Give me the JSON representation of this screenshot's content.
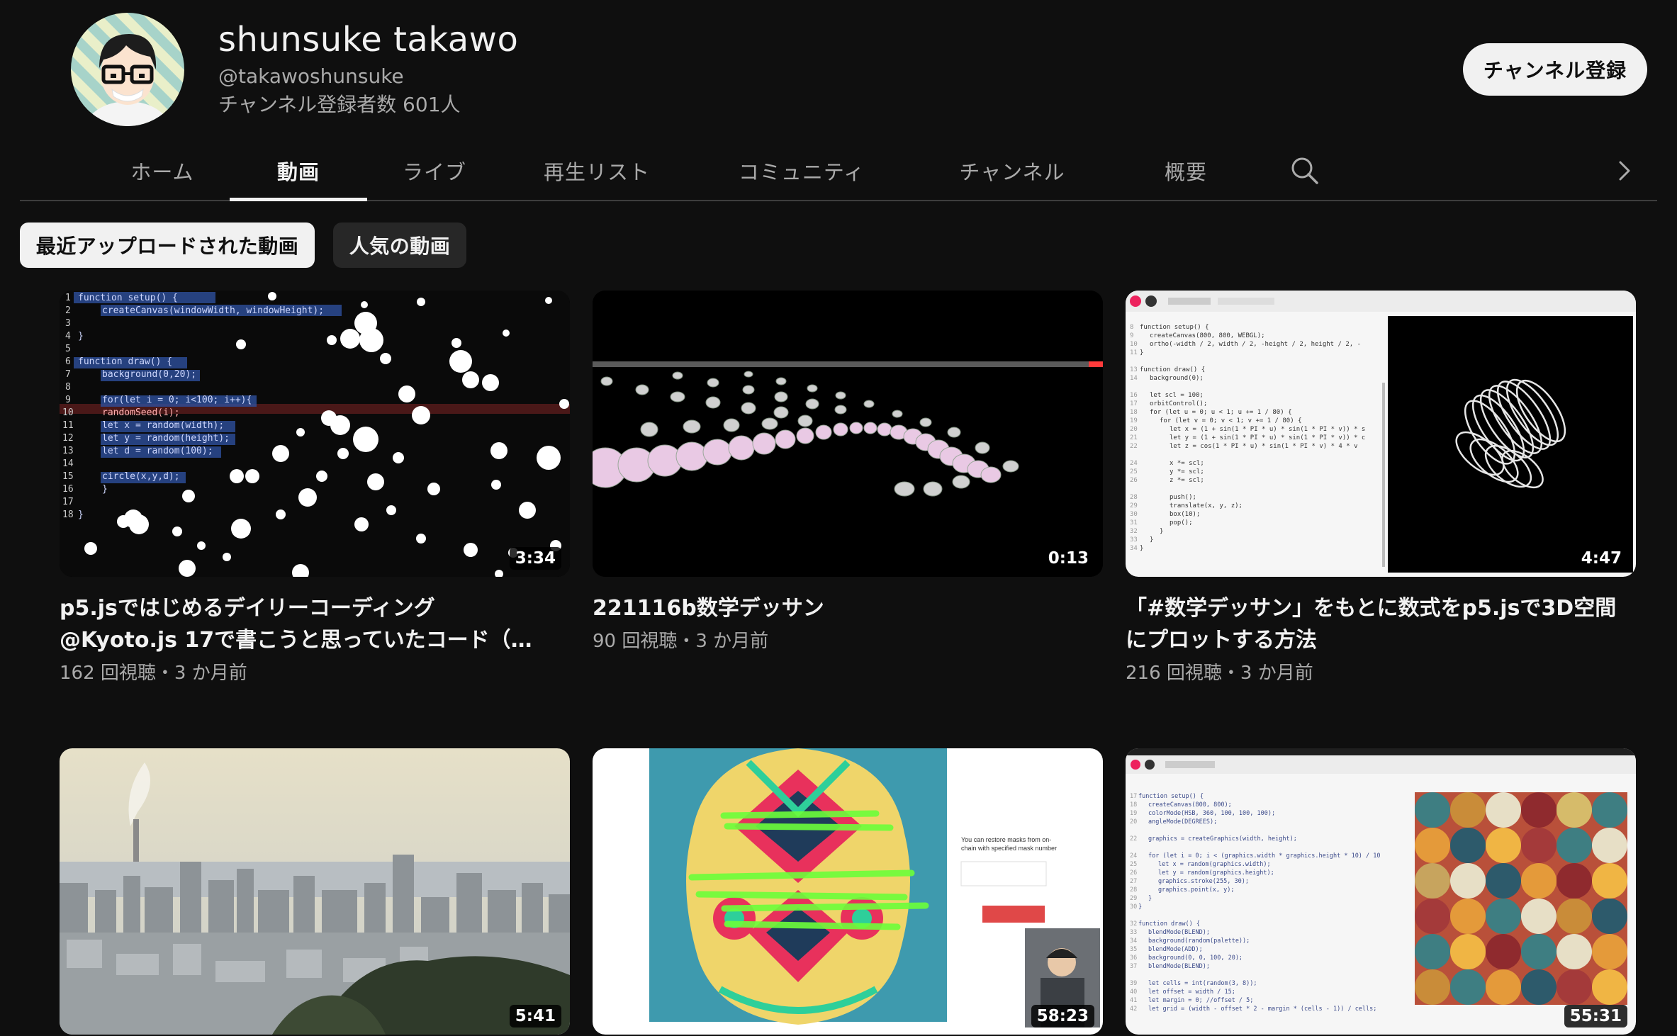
{
  "channel": {
    "name": "shunsuke takawo",
    "handle": "@takawoshunsuke",
    "subscribers": "チャンネル登録者数 601人",
    "subscribe_label": "チャンネル登録"
  },
  "tabs": [
    {
      "label": "ホーム"
    },
    {
      "label": "動画",
      "active": true
    },
    {
      "label": "ライブ"
    },
    {
      "label": "再生リスト"
    },
    {
      "label": "コミュニティ"
    },
    {
      "label": "チャンネル"
    },
    {
      "label": "概要"
    }
  ],
  "tab_icons": {
    "search": "search-icon",
    "next": "chevron-right-icon"
  },
  "filters": [
    {
      "label": "最近アップロードされた動画",
      "selected": true
    },
    {
      "label": "人気の動画",
      "selected": false
    }
  ],
  "videos": [
    {
      "title": "p5.jsではじめるデイリーコーディング @Kyoto.js 17で書こうと思っていたコード（…",
      "meta": "162 回視聴・3 か月前",
      "duration": "3:34",
      "thumbnail": "code-circles"
    },
    {
      "title": "221116b数学デッサン",
      "meta": "90 回視聴・3 か月前",
      "duration": "0:13",
      "thumbnail": "sphere-wave"
    },
    {
      "title": "「#数学デッサン」をもとに数式をp5.jsで3D空間にプロットする方法",
      "meta": "216 回視聴・3 か月前",
      "duration": "4:47",
      "thumbnail": "editor-torus"
    },
    {
      "title": "",
      "meta": "",
      "duration": "5:41",
      "thumbnail": "city-view"
    },
    {
      "title": "",
      "meta": "",
      "duration": "58:23",
      "thumbnail": "mask-pattern"
    },
    {
      "title": "",
      "meta": "",
      "duration": "55:31",
      "thumbnail": "editor-grid"
    }
  ],
  "colors": {
    "background": "#0f0f0f",
    "text_primary": "#f1f1f1",
    "text_secondary": "#aaaaaa",
    "chip_bg": "#272727"
  }
}
